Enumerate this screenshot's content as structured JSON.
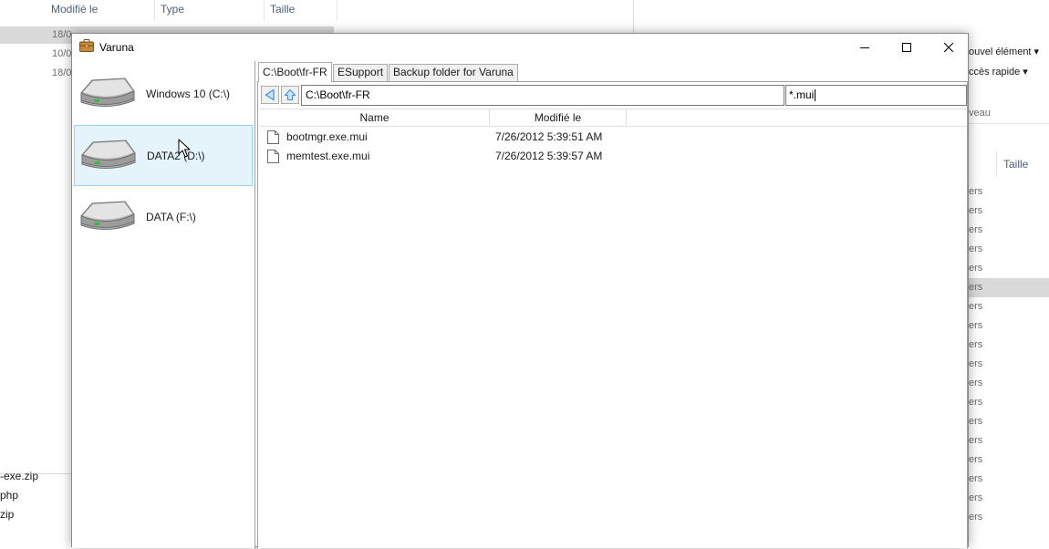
{
  "background_left": {
    "columns": [
      "Modifié le",
      "Type",
      "Taille"
    ],
    "dates": [
      "18/0",
      "10/0",
      "18/0"
    ],
    "files": [
      "-exe.zip",
      "php",
      "zip"
    ]
  },
  "background_right": {
    "ribbon": {
      "new_item": "ouvel élément ▾",
      "quick_access": "ccès rapide ▾",
      "level": "veau"
    },
    "column_header": "Taille",
    "rows": [
      "ers",
      "ers",
      "ers",
      "ers",
      "ers",
      "ers",
      "ers",
      "ers",
      "ers",
      "ers",
      "ers",
      "ers",
      "ers",
      "ers",
      "ers",
      "ers",
      "ers",
      "ers"
    ]
  },
  "window": {
    "title": "Varuna"
  },
  "drives": [
    {
      "label": "Windows 10 (C:\\)"
    },
    {
      "label": "DATA2 (D:\\)"
    },
    {
      "label": "DATA (F:\\)"
    }
  ],
  "tabs": [
    {
      "label": "C:\\Boot\\fr-FR"
    },
    {
      "label": "ESupport"
    },
    {
      "label": "Backup folder for Varuna"
    }
  ],
  "nav": {
    "path": "C:\\Boot\\fr-FR",
    "filter": "*.mui"
  },
  "list": {
    "headers": {
      "name": "Name",
      "modified": "Modifié le"
    },
    "rows": [
      {
        "name": "bootmgr.exe.mui",
        "modified": "7/26/2012 5:39:51 AM"
      },
      {
        "name": "memtest.exe.mui",
        "modified": "7/26/2012 5:39:57 AM"
      }
    ]
  },
  "colors": {
    "selection_bg": "#e5f3fb",
    "selection_border": "#99d1f1",
    "nav_arrow": "#3a8ee6"
  }
}
